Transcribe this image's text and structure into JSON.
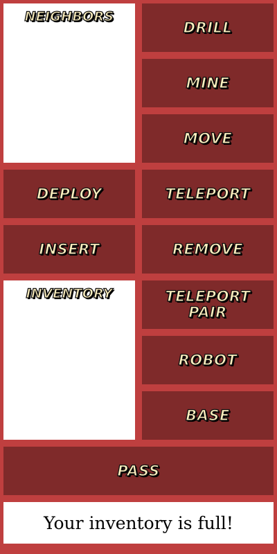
{
  "neighbors": {
    "title": "NEIGHBORS"
  },
  "inventory": {
    "title": "INVENTORY"
  },
  "actions": {
    "drill": "DRILL",
    "mine": "MINE",
    "move": "MOVE",
    "deploy": "DEPLOY",
    "teleport": "TELEPORT",
    "insert": "INSERT",
    "remove": "REMOVE",
    "teleport_pair": "TELEPORT\nPAIR",
    "robot": "ROBOT",
    "base": "BASE",
    "pass": "PASS"
  },
  "status": {
    "message": "Your inventory is full!"
  },
  "colors": {
    "background": "#bf3f3f",
    "button": "#7f2a2a",
    "label": "#fff1c0",
    "panel": "#ffffff"
  }
}
